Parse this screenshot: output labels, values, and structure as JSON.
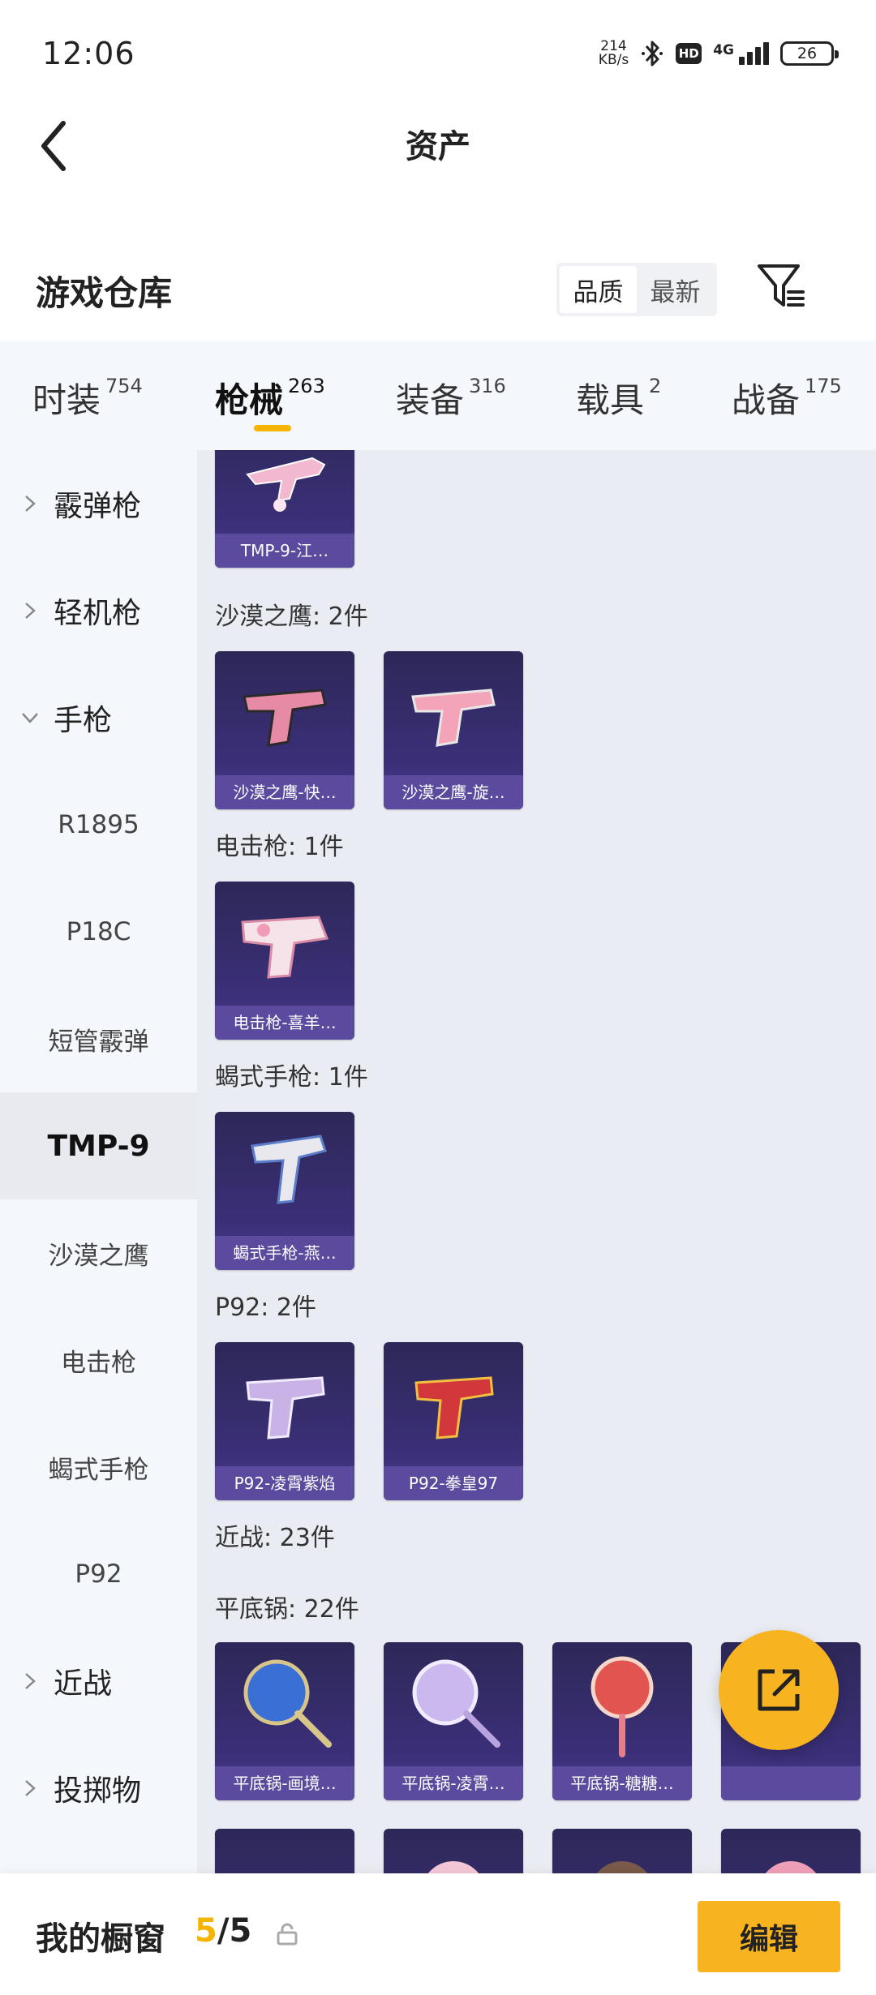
{
  "status_bar": {
    "time": "12:06",
    "net_speed_value": "214",
    "net_speed_unit": "KB/s",
    "hd_label": "HD",
    "signal_label": "4G",
    "battery": "26"
  },
  "header": {
    "title": "资产"
  },
  "warehouse": {
    "title": "游戏仓库",
    "sort_options": [
      "品质",
      "最新"
    ]
  },
  "category_tabs": [
    {
      "name": "时装",
      "count": "754"
    },
    {
      "name": "枪械",
      "count": "263",
      "active": true
    },
    {
      "name": "装备",
      "count": "316"
    },
    {
      "name": "载具",
      "count": "2"
    },
    {
      "name": "战备",
      "count": "175"
    }
  ],
  "side_nav": [
    {
      "label": "霰弹枪",
      "type": "group"
    },
    {
      "label": "轻机枪",
      "type": "group"
    },
    {
      "label": "手枪",
      "type": "group",
      "expanded": true
    },
    {
      "label": "R1895",
      "type": "sub"
    },
    {
      "label": "P18C",
      "type": "sub"
    },
    {
      "label": "短管霰弹",
      "type": "sub"
    },
    {
      "label": "TMP-9",
      "type": "sub",
      "selected": true
    },
    {
      "label": "沙漠之鹰",
      "type": "sub"
    },
    {
      "label": "电击枪",
      "type": "sub"
    },
    {
      "label": "蝎式手枪",
      "type": "sub"
    },
    {
      "label": "P92",
      "type": "sub"
    },
    {
      "label": "近战",
      "type": "group"
    },
    {
      "label": "投掷物",
      "type": "group"
    }
  ],
  "content": {
    "sections": [
      {
        "label": "沙漠之鹰: 2件"
      },
      {
        "label": "电击枪: 1件"
      },
      {
        "label": "蝎式手枪: 1件"
      },
      {
        "label": "P92: 2件"
      },
      {
        "label": "近战: 23件"
      },
      {
        "label": "平底锅: 22件"
      }
    ],
    "items": [
      {
        "name": "TMP-9-江…"
      },
      {
        "name": "沙漠之鹰-快…"
      },
      {
        "name": "沙漠之鹰-旋…"
      },
      {
        "name": "电击枪-喜羊…"
      },
      {
        "name": "蝎式手枪-燕…"
      },
      {
        "name": "P92-凌霄紫焰"
      },
      {
        "name": "P92-拳皇97"
      },
      {
        "name": "平底锅-画境…"
      },
      {
        "name": "平底锅-凌霄…"
      },
      {
        "name": "平底锅-糖糖…"
      },
      {
        "name": ""
      }
    ]
  },
  "bottom_bar": {
    "label": "我的橱窗",
    "current": "5",
    "separator": "/",
    "total": "5",
    "edit_label": "编辑"
  },
  "colors": {
    "accent": "#f8b321",
    "card_bg": "#3b2f78",
    "card_name_bg": "#5b4a9e",
    "nav_bg": "#f4f7fb",
    "content_bg": "#e9ecf2"
  },
  "icons": [
    "back-arrow-icon",
    "filter-icon",
    "chevron-right-icon",
    "chevron-down-icon",
    "share-icon",
    "lock-icon",
    "bluetooth-icon"
  ]
}
